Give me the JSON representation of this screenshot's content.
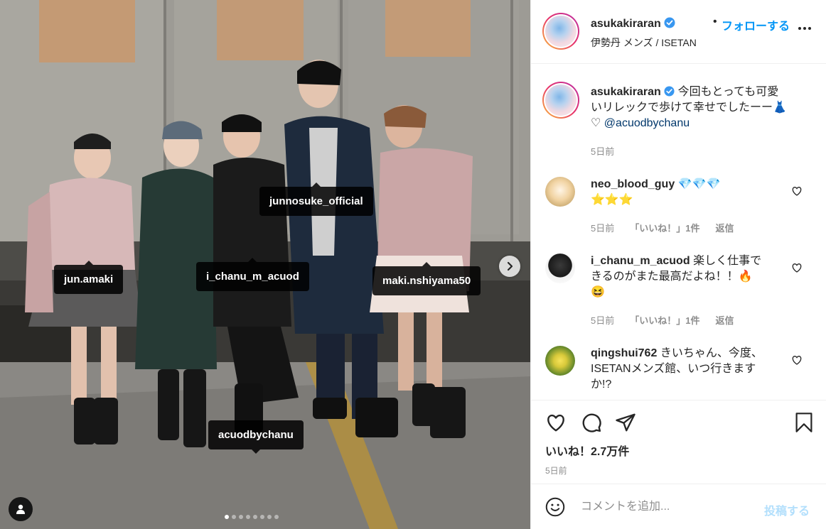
{
  "photo": {
    "tags": [
      {
        "name": "jun.amaki"
      },
      {
        "name": "i_chanu_m_acuod"
      },
      {
        "name": "junnosuke_official"
      },
      {
        "name": "maki.nshiyama50"
      },
      {
        "name": "acuodbychanu"
      }
    ],
    "carousel": {
      "count": 8,
      "active": 1
    },
    "icons": {
      "next": "chevron-right-icon",
      "user_tags": "user-icon"
    }
  },
  "header": {
    "username": "asukakiraran",
    "separator": "•",
    "follow": "フォローする",
    "location": "伊勢丹 メンズ / ISETAN",
    "more_icon": "more-options-icon"
  },
  "caption": {
    "username": "asukakiraran",
    "line1": "今回もとっても可愛",
    "line2": "いリレックで歩けて幸せでしたーー👗",
    "heart": "♡",
    "mention": "@acuodbychanu",
    "time": "5日前"
  },
  "comments": [
    {
      "username": "neo_blood_guy",
      "text": "💎💎💎",
      "text2": "⭐⭐⭐",
      "time": "5日前",
      "likes": "「いいね！」1件",
      "reply": "返信"
    },
    {
      "username": "i_chanu_m_acuod",
      "text": "楽しく仕事で",
      "text2": "きるのがまた最高だよね！！🔥",
      "text3": "😆",
      "time": "5日前",
      "likes": "「いいね！」1件",
      "reply": "返信"
    },
    {
      "username": "qingshui762",
      "text": "きいちゃん、今度、",
      "text2": "ISETANメンズ館、いつ行きます",
      "text3": "か!?"
    }
  ],
  "actions": {
    "icons": [
      "heart-icon",
      "comment-icon",
      "share-icon",
      "bookmark-icon"
    ],
    "likes": "いいね！2.7万件",
    "date": "5日前"
  },
  "composer": {
    "placeholder": "コメントを追加...",
    "post": "投稿する",
    "emoji_icon": "emoji-icon"
  },
  "colors": {
    "accent": "#0095f6",
    "text": "#262626",
    "muted": "#8e8e8e",
    "post_disabled": "#b2dffc",
    "mention": "#00376b"
  }
}
